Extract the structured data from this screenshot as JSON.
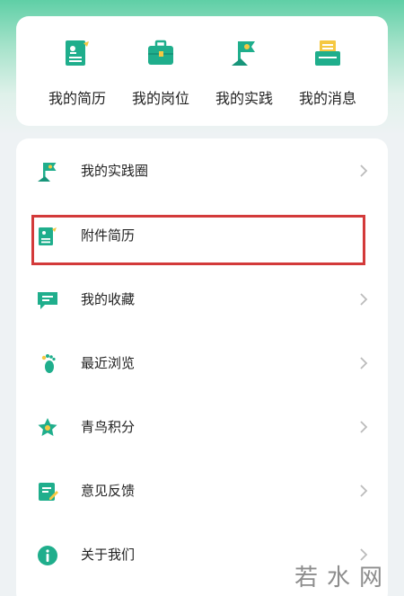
{
  "quick_actions": [
    {
      "label": "我的简历",
      "icon": "resume-icon"
    },
    {
      "label": "我的岗位",
      "icon": "briefcase-icon"
    },
    {
      "label": "我的实践",
      "icon": "practice-flag-icon"
    },
    {
      "label": "我的消息",
      "icon": "message-icon"
    }
  ],
  "menu": [
    {
      "label": "我的实践圈",
      "icon": "practice-circle-icon"
    },
    {
      "label": "附件简历",
      "icon": "attachment-resume-icon"
    },
    {
      "label": "我的收藏",
      "icon": "favorites-icon"
    },
    {
      "label": "最近浏览",
      "icon": "footprint-icon"
    },
    {
      "label": "青鸟积分",
      "icon": "star-points-icon"
    },
    {
      "label": "意见反馈",
      "icon": "feedback-icon"
    },
    {
      "label": "关于我们",
      "icon": "info-icon"
    }
  ],
  "colors": {
    "accent": "#1fae8c",
    "highlight": "#d33a3a",
    "icon_yellow": "#f5c842"
  },
  "watermark": "若水网"
}
